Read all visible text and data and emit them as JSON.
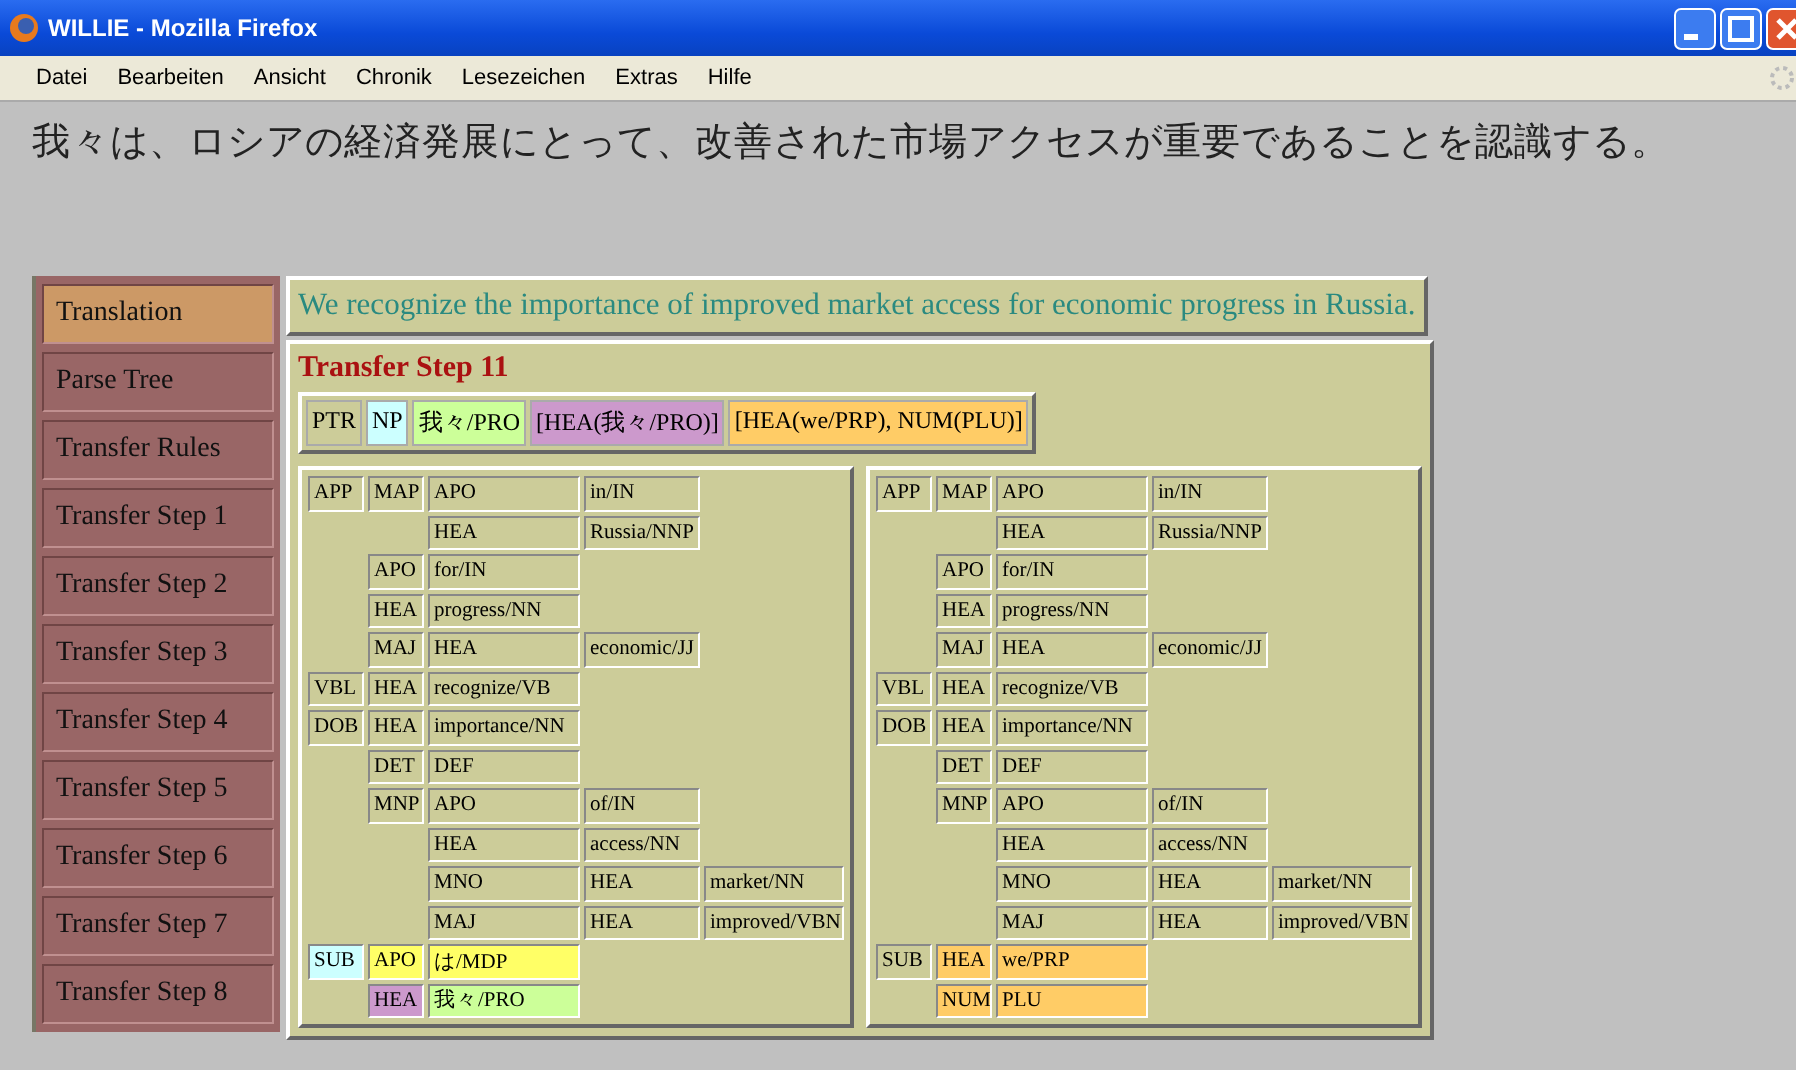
{
  "window": {
    "title": "WILLIE - Mozilla Firefox"
  },
  "menu": [
    "Datei",
    "Bearbeiten",
    "Ansicht",
    "Chronik",
    "Lesezeichen",
    "Extras",
    "Hilfe"
  ],
  "source_sentence": "我々は、ロシアの経済発展にとって、改善された市場アクセスが重要であることを認識する。",
  "sidebar": {
    "items": [
      {
        "label": "Translation",
        "selected": true
      },
      {
        "label": "Parse Tree",
        "selected": false
      },
      {
        "label": "Transfer Rules",
        "selected": false
      },
      {
        "label": "Transfer Step 1",
        "selected": false
      },
      {
        "label": "Transfer Step 2",
        "selected": false
      },
      {
        "label": "Transfer Step 3",
        "selected": false
      },
      {
        "label": "Transfer Step 4",
        "selected": false
      },
      {
        "label": "Transfer Step 5",
        "selected": false
      },
      {
        "label": "Transfer Step 6",
        "selected": false
      },
      {
        "label": "Transfer Step 7",
        "selected": false
      },
      {
        "label": "Transfer Step 8",
        "selected": false
      }
    ]
  },
  "translation": "We recognize the importance of improved market access for economic progress in Russia.",
  "step": {
    "title": "Transfer Step 11",
    "chips": [
      {
        "label": "PTR"
      },
      {
        "label": "NP",
        "color": "#ccffff"
      },
      {
        "label": "我々/PRO",
        "color": "#ccff99"
      },
      {
        "label": "[HEA(我々/PRO)]",
        "color": "#cc99cc"
      },
      {
        "label": "[HEA(we/PRP), NUM(PLU)]",
        "color": "#ffcc66"
      }
    ],
    "trees": [
      [
        {
          "label": "APP",
          "children": [
            {
              "label": "MAP",
              "children": [
                {
                  "label": "APO",
                  "children": [
                    {
                      "label": "in/IN"
                    }
                  ]
                },
                {
                  "label": "HEA",
                  "children": [
                    {
                      "label": "Russia/NNP"
                    }
                  ]
                }
              ]
            },
            {
              "label": "APO",
              "children": [
                {
                  "label": "for/IN"
                }
              ]
            },
            {
              "label": "HEA",
              "children": [
                {
                  "label": "progress/NN"
                }
              ]
            },
            {
              "label": "MAJ",
              "children": [
                {
                  "label": "HEA",
                  "children": [
                    {
                      "label": "economic/JJ"
                    }
                  ]
                }
              ]
            }
          ]
        },
        {
          "label": "VBL",
          "children": [
            {
              "label": "HEA",
              "children": [
                {
                  "label": "recognize/VB"
                }
              ]
            }
          ]
        },
        {
          "label": "DOB",
          "children": [
            {
              "label": "HEA",
              "children": [
                {
                  "label": "importance/NN"
                }
              ]
            },
            {
              "label": "DET",
              "children": [
                {
                  "label": "DEF"
                }
              ]
            },
            {
              "label": "MNP",
              "children": [
                {
                  "label": "APO",
                  "children": [
                    {
                      "label": "of/IN"
                    }
                  ]
                },
                {
                  "label": "HEA",
                  "children": [
                    {
                      "label": "access/NN"
                    }
                  ]
                },
                {
                  "label": "MNO",
                  "children": [
                    {
                      "label": "HEA",
                      "children": [
                        {
                          "label": "market/NN"
                        }
                      ]
                    }
                  ]
                },
                {
                  "label": "MAJ",
                  "children": [
                    {
                      "label": "HEA",
                      "children": [
                        {
                          "label": "improved/VBN"
                        }
                      ]
                    }
                  ]
                }
              ]
            }
          ]
        },
        {
          "label": "SUB",
          "color": "#ccffff",
          "children": [
            {
              "label": "APO",
              "color": "#ffff66",
              "children": [
                {
                  "label": "は/MDP",
                  "color": "#ffff66"
                }
              ]
            },
            {
              "label": "HEA",
              "color": "#cc99cc",
              "children": [
                {
                  "label": "我々/PRO",
                  "color": "#ccff99"
                }
              ]
            }
          ]
        }
      ],
      [
        {
          "label": "APP",
          "children": [
            {
              "label": "MAP",
              "children": [
                {
                  "label": "APO",
                  "children": [
                    {
                      "label": "in/IN"
                    }
                  ]
                },
                {
                  "label": "HEA",
                  "children": [
                    {
                      "label": "Russia/NNP"
                    }
                  ]
                }
              ]
            },
            {
              "label": "APO",
              "children": [
                {
                  "label": "for/IN"
                }
              ]
            },
            {
              "label": "HEA",
              "children": [
                {
                  "label": "progress/NN"
                }
              ]
            },
            {
              "label": "MAJ",
              "children": [
                {
                  "label": "HEA",
                  "children": [
                    {
                      "label": "economic/JJ"
                    }
                  ]
                }
              ]
            }
          ]
        },
        {
          "label": "VBL",
          "children": [
            {
              "label": "HEA",
              "children": [
                {
                  "label": "recognize/VB"
                }
              ]
            }
          ]
        },
        {
          "label": "DOB",
          "children": [
            {
              "label": "HEA",
              "children": [
                {
                  "label": "importance/NN"
                }
              ]
            },
            {
              "label": "DET",
              "children": [
                {
                  "label": "DEF"
                }
              ]
            },
            {
              "label": "MNP",
              "children": [
                {
                  "label": "APO",
                  "children": [
                    {
                      "label": "of/IN"
                    }
                  ]
                },
                {
                  "label": "HEA",
                  "children": [
                    {
                      "label": "access/NN"
                    }
                  ]
                },
                {
                  "label": "MNO",
                  "children": [
                    {
                      "label": "HEA",
                      "children": [
                        {
                          "label": "market/NN"
                        }
                      ]
                    }
                  ]
                },
                {
                  "label": "MAJ",
                  "children": [
                    {
                      "label": "HEA",
                      "children": [
                        {
                          "label": "improved/VBN"
                        }
                      ]
                    }
                  ]
                }
              ]
            }
          ]
        },
        {
          "label": "SUB",
          "children": [
            {
              "label": "HEA",
              "color": "#ffcc66",
              "children": [
                {
                  "label": "we/PRP",
                  "color": "#ffcc66"
                }
              ]
            },
            {
              "label": "NUM",
              "color": "#ffcc66",
              "children": [
                {
                  "label": "PLU",
                  "color": "#ffcc66"
                }
              ]
            }
          ]
        }
      ]
    ]
  }
}
